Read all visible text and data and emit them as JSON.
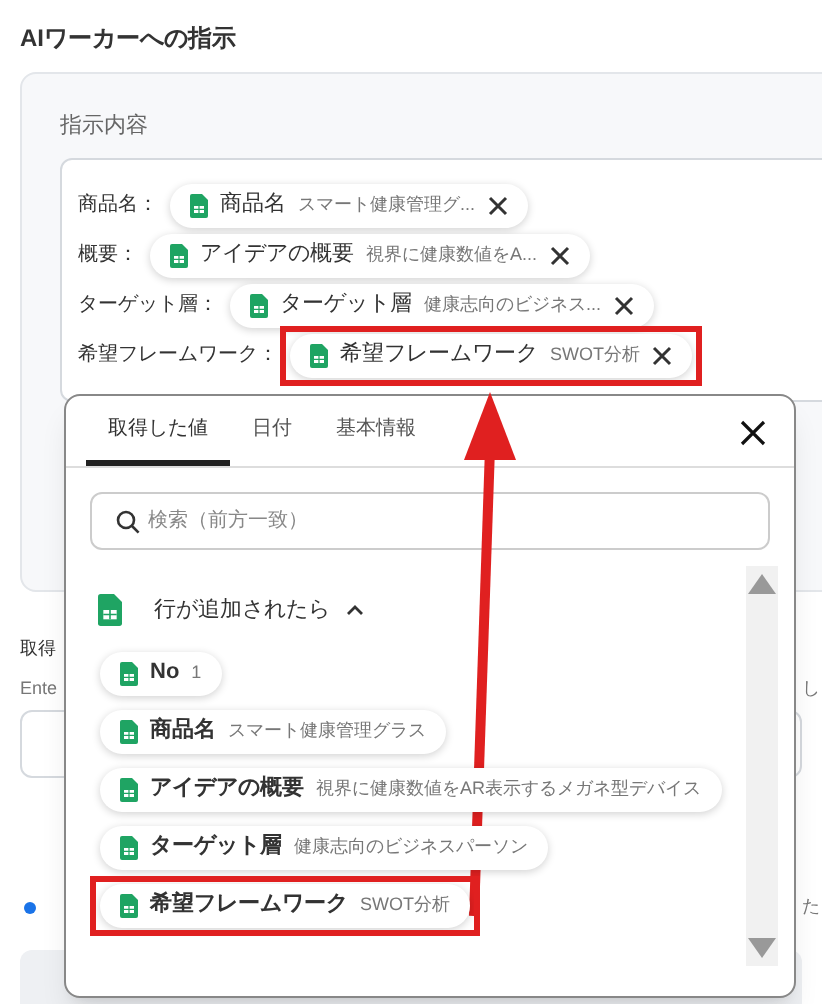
{
  "section_title": "AIワーカーへの指示",
  "instruction": {
    "label": "指示内容",
    "rows": [
      {
        "label": "商品名：",
        "chip": {
          "name": "商品名",
          "value": "スマート健康管理グ...",
          "highlighted": false
        }
      },
      {
        "label": "概要：",
        "chip": {
          "name": "アイデアの概要",
          "value": "視界に健康数値をA...",
          "highlighted": false
        }
      },
      {
        "label": "ターゲット層：",
        "chip": {
          "name": "ターゲット層",
          "value": "健康志向のビジネス...",
          "highlighted": false
        }
      },
      {
        "label": "希望フレームワーク：",
        "chip": {
          "name": "希望フレームワーク",
          "value": "SWOT分析",
          "highlighted": true
        }
      }
    ]
  },
  "background": {
    "label": "取得",
    "hint": "Ente",
    "right_text_1": "し",
    "right_text_2": "た"
  },
  "popup": {
    "tabs": [
      {
        "label": "取得した値",
        "selected": true
      },
      {
        "label": "日付",
        "selected": false
      },
      {
        "label": "基本情報",
        "selected": false
      }
    ],
    "search": {
      "placeholder": "検索（前方一致）"
    },
    "group": {
      "title": "行が追加されたら",
      "expanded": true,
      "items": [
        {
          "name": "No",
          "value": "1",
          "highlighted": false
        },
        {
          "name": "商品名",
          "value": "スマート健康管理グラス",
          "highlighted": false
        },
        {
          "name": "アイデアの概要",
          "value": "視界に健康数値をAR表示するメガネ型デバイス",
          "highlighted": false
        },
        {
          "name": "ターゲット層",
          "value": "健康志向のビジネスパーソン",
          "highlighted": false
        },
        {
          "name": "希望フレームワーク",
          "value": "SWOT分析",
          "highlighted": true
        }
      ]
    }
  }
}
